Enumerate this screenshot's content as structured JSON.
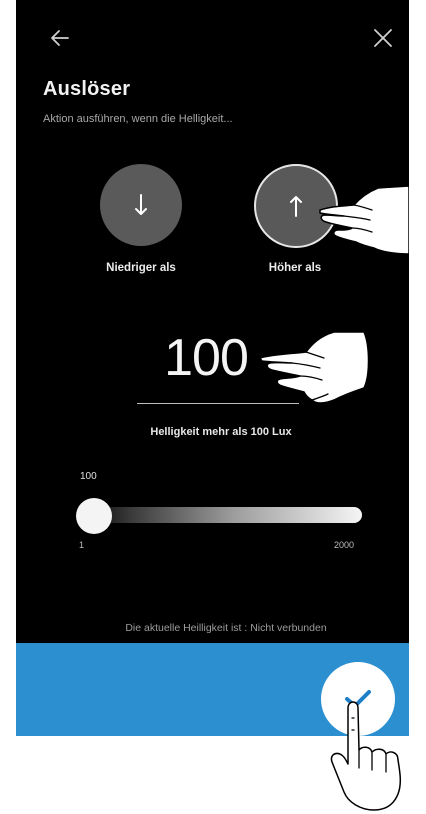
{
  "header": {
    "title": "Auslöser",
    "subtitle": "Aktion ausführen, wenn die Helligkeit..."
  },
  "direction": {
    "lower_label": "Niedriger als",
    "higher_label": "Höher als",
    "selected": "higher"
  },
  "threshold": {
    "value": "100",
    "summary": "Helligkeit mehr als 100 Lux"
  },
  "slider": {
    "current": "100",
    "min": "1",
    "max": "2000",
    "level_fraction": 0.05
  },
  "status": {
    "text": "Die aktuelle Heilligkeit ist : Nicht verbunden"
  },
  "icons": {
    "back": "arrow-left-icon",
    "close": "close-icon",
    "lower": "arrow-down-icon",
    "higher": "arrow-up-icon",
    "confirm": "checkmark-icon"
  },
  "colors": {
    "background": "#000000",
    "footer": "#2b8fd0",
    "check": "#1e7fc8"
  }
}
